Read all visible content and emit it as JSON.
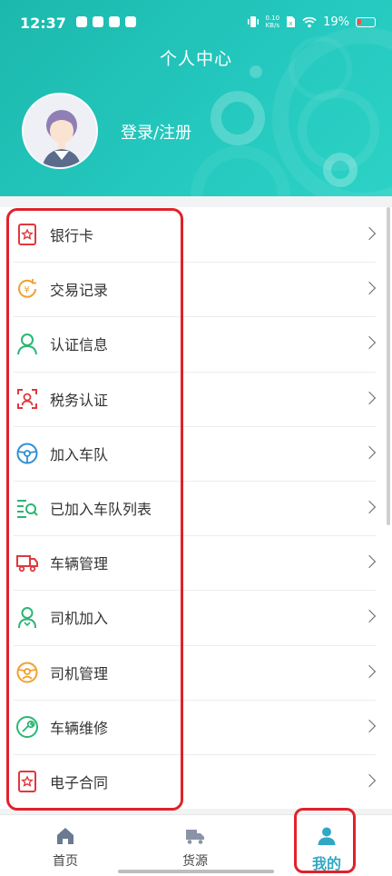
{
  "status_bar": {
    "time": "12:37",
    "net_speed": "0.10",
    "net_unit": "KB/s",
    "battery": "19%"
  },
  "header": {
    "title": "个人中心",
    "login_label": "登录/注册"
  },
  "menu": {
    "items": [
      {
        "label": "银行卡",
        "icon": "bank-card-icon",
        "color": "#e0383e"
      },
      {
        "label": "交易记录",
        "icon": "transaction-record-icon",
        "color": "#f0a030"
      },
      {
        "label": "认证信息",
        "icon": "user-verify-icon",
        "color": "#2bb673"
      },
      {
        "label": "税务认证",
        "icon": "face-scan-icon",
        "color": "#e0383e"
      },
      {
        "label": "加入车队",
        "icon": "steering-wheel-icon",
        "color": "#2f8fd6"
      },
      {
        "label": "已加入车队列表",
        "icon": "list-search-icon",
        "color": "#2bb673"
      },
      {
        "label": "车辆管理",
        "icon": "truck-icon",
        "color": "#e0383e"
      },
      {
        "label": "司机加入",
        "icon": "driver-add-icon",
        "color": "#2bb673"
      },
      {
        "label": "司机管理",
        "icon": "driver-manage-icon",
        "color": "#f0a030"
      },
      {
        "label": "车辆维修",
        "icon": "wrench-icon",
        "color": "#2bb673"
      },
      {
        "label": "电子合同",
        "icon": "contract-icon",
        "color": "#e0383e"
      }
    ]
  },
  "tabbar": {
    "tabs": [
      {
        "label": "首页",
        "icon": "home-icon"
      },
      {
        "label": "货源",
        "icon": "cargo-truck-icon"
      },
      {
        "label": "我的",
        "icon": "user-icon",
        "active": true
      }
    ]
  },
  "colors": {
    "header": "#22c2b6",
    "accent": "#2fa8c6",
    "highlight": "#e0222a"
  }
}
